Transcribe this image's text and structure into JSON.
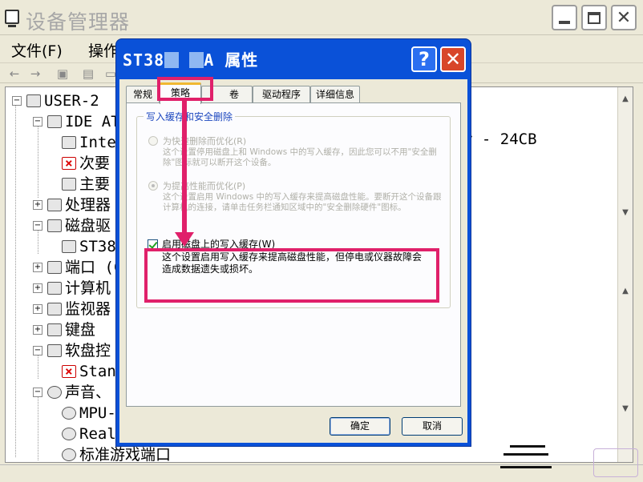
{
  "background_window": {
    "title": "设备管理器",
    "menus": [
      "文件(F)",
      "操作"
    ],
    "tree": [
      {
        "label": "USER-2",
        "level": 0,
        "toggle": "−"
      },
      {
        "label": "IDE AT",
        "level": 1,
        "toggle": "−"
      },
      {
        "label": "Inte",
        "level": 2
      },
      {
        "label": "次要",
        "level": 2,
        "error": true
      },
      {
        "label": "主要",
        "level": 2
      },
      {
        "label": "处理器",
        "level": 1,
        "toggle": "+"
      },
      {
        "label": "磁盘驱",
        "level": 1,
        "toggle": "−"
      },
      {
        "label": "ST38",
        "level": 2
      },
      {
        "label": "端口 (C",
        "level": 1,
        "toggle": "+"
      },
      {
        "label": "计算机",
        "level": 1,
        "toggle": "+"
      },
      {
        "label": "监视器",
        "level": 1,
        "toggle": "+"
      },
      {
        "label": "键盘",
        "level": 1,
        "toggle": "+"
      },
      {
        "label": "软盘控",
        "level": 1,
        "toggle": "−"
      },
      {
        "label": "Stan",
        "level": 2,
        "error": true
      },
      {
        "label": "声音、",
        "level": 1,
        "toggle": "−"
      },
      {
        "label": "MPU-",
        "level": 2
      },
      {
        "label": "Real",
        "level": 2
      },
      {
        "label": "标准游戏端口",
        "level": 2
      }
    ],
    "right_text": "r - 24CB"
  },
  "dialog": {
    "title_prefix": "ST38",
    "title_middle": "A",
    "title_suffix": "属性",
    "help_label": "?",
    "close_label": "✕",
    "tabs": [
      "常规",
      "策略",
      "卷",
      "驱动程序",
      "详细信息"
    ],
    "active_tab": 1,
    "group_title": "写入缓存和安全删除",
    "option1": {
      "label": "为快速删除而优化(R)",
      "desc": "这个设置停用磁盘上和 Windows 中的写入缓存，因此您可以不用\"安全删除\"图标就可以断开这个设备。"
    },
    "option2": {
      "label": "为提高性能而优化(P)",
      "desc": "这个设置启用 Windows 中的写入缓存来提高磁盘性能。要断开这个设备跟计算机的连接，请单击任务栏通知区域中的\"安全删除硬件\"图标。"
    },
    "checkbox": {
      "label": "启用磁盘上的写入缓存(W)",
      "checked": true,
      "desc": "这个设置启用写入缓存来提高磁盘性能，但停电或仪器故障会造成数据遗失或损坏。"
    },
    "ok_label": "确定",
    "cancel_label": "取消"
  },
  "annotations": {
    "color": "#e0206a"
  }
}
